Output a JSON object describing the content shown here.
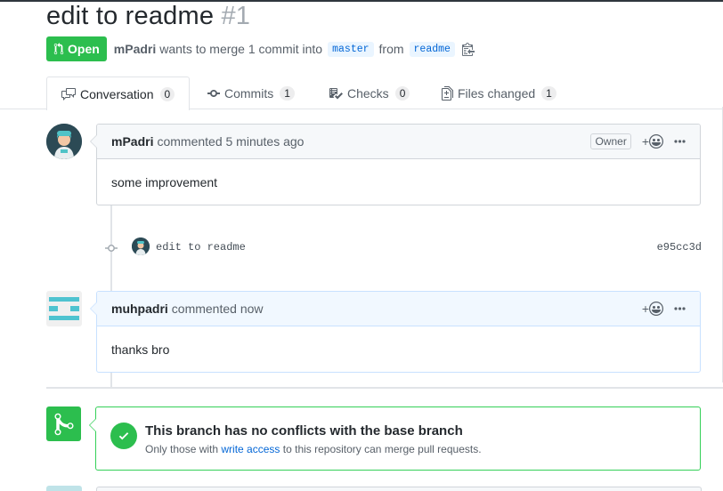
{
  "pr": {
    "title": "edit to readme",
    "number": "#1",
    "state": "Open",
    "author": "mPadri",
    "merge_text": "wants to merge 1 commit into",
    "base_branch": "master",
    "from_text": "from",
    "head_branch": "readme"
  },
  "tabs": [
    {
      "label": "Conversation",
      "count": "0"
    },
    {
      "label": "Commits",
      "count": "1"
    },
    {
      "label": "Checks",
      "count": "0"
    },
    {
      "label": "Files changed",
      "count": "1"
    }
  ],
  "comments": [
    {
      "author": "mPadri",
      "action": "commented 5 minutes ago",
      "label": "Owner",
      "body": "some improvement"
    },
    {
      "author": "muhpadri",
      "action": "commented now",
      "body": "thanks bro"
    }
  ],
  "commit": {
    "message": "edit to readme",
    "sha": "e95cc3d"
  },
  "merge": {
    "title": "This branch has no conflicts with the base branch",
    "sub_before": "Only those with",
    "link": "write access",
    "sub_after": "to this repository can merge pull requests."
  },
  "colors": {
    "open_green": "#2cbe4e",
    "link_blue": "#0366d6"
  }
}
